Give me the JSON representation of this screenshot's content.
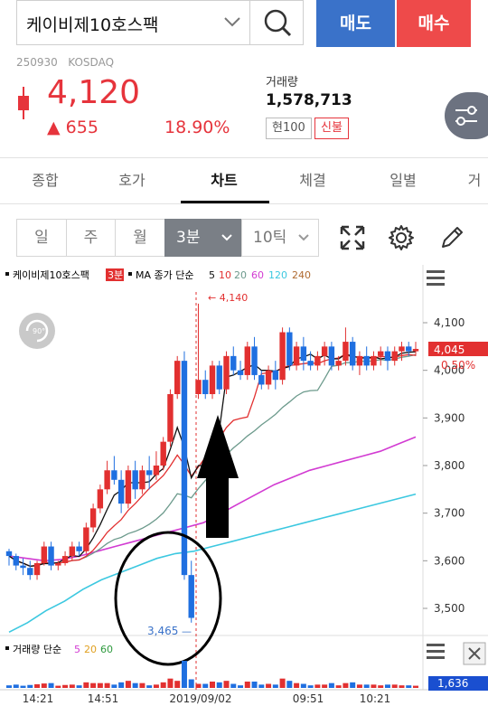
{
  "search": {
    "value": "케이비제10호스팩"
  },
  "actions": {
    "sell": "매도",
    "buy": "매수"
  },
  "stock": {
    "code": "250930",
    "market": "KOSDAQ",
    "price": "4,120",
    "change": "▲ 655",
    "change_pct": "18.90%",
    "volume_label": "거래량",
    "volume": "1,578,713",
    "tags": [
      "현100",
      "신불"
    ]
  },
  "tabs": [
    "종합",
    "호가",
    "차트",
    "체결",
    "일별",
    "거"
  ],
  "active_tab": "차트",
  "periods": [
    "일",
    "주",
    "월",
    "3분",
    "10틱"
  ],
  "selected_period": "3분",
  "chart_legend": {
    "name": "케이비제10호스팩",
    "interval": "3분",
    "ma_label": "MA 종가 단순",
    "ma_periods": [
      "5",
      "10",
      "20",
      "60",
      "120",
      "240"
    ],
    "ma_colors": [
      "#111111",
      "#e23030",
      "#6c9a8c",
      "#d23bd2",
      "#3cc8e0",
      "#b06a30"
    ]
  },
  "volume_legend": {
    "label": "거래량 단순",
    "periods": [
      "5",
      "20",
      "60"
    ],
    "colors": [
      "#d23bd2",
      "#e0a020",
      "#2e9a3e"
    ],
    "last": "1,636"
  },
  "chart_data": {
    "type": "candlestick",
    "y_ticks": [
      "4,100",
      "4,000",
      "3,900",
      "3,800",
      "3,700",
      "3,600",
      "3,500"
    ],
    "x_ticks": [
      "14:21",
      "14:51",
      "2019/09/02",
      "09:51",
      "10:21"
    ],
    "high_label": "4,140",
    "low_label": "3,465",
    "last_price": "4,045",
    "last_pct": "0.50%",
    "candles": [
      [
        3620,
        3625,
        3590,
        3610
      ],
      [
        3610,
        3615,
        3580,
        3590
      ],
      [
        3590,
        3605,
        3570,
        3585
      ],
      [
        3585,
        3600,
        3560,
        3570
      ],
      [
        3570,
        3600,
        3560,
        3595
      ],
      [
        3595,
        3640,
        3590,
        3630
      ],
      [
        3630,
        3640,
        3580,
        3590
      ],
      [
        3590,
        3600,
        3580,
        3595
      ],
      [
        3595,
        3620,
        3590,
        3610
      ],
      [
        3610,
        3640,
        3600,
        3630
      ],
      [
        3630,
        3640,
        3610,
        3620
      ],
      [
        3620,
        3680,
        3615,
        3670
      ],
      [
        3670,
        3720,
        3660,
        3710
      ],
      [
        3710,
        3760,
        3700,
        3750
      ],
      [
        3750,
        3810,
        3740,
        3790
      ],
      [
        3790,
        3820,
        3760,
        3770
      ],
      [
        3770,
        3790,
        3700,
        3720
      ],
      [
        3720,
        3800,
        3710,
        3790
      ],
      [
        3790,
        3810,
        3730,
        3750
      ],
      [
        3750,
        3800,
        3740,
        3790
      ],
      [
        3790,
        3820,
        3750,
        3780
      ],
      [
        3780,
        3830,
        3770,
        3800
      ],
      [
        3800,
        3860,
        3790,
        3850
      ],
      [
        3850,
        3960,
        3840,
        3950
      ],
      [
        3950,
        4030,
        3940,
        4020
      ],
      [
        4020,
        4040,
        3560,
        3570
      ],
      [
        3570,
        3600,
        3470,
        3480
      ],
      [
        3950,
        4140,
        3940,
        3980
      ],
      [
        3980,
        4000,
        3940,
        3950
      ],
      [
        3950,
        4020,
        3940,
        4010
      ],
      [
        4010,
        4020,
        3950,
        3960
      ],
      [
        3960,
        4040,
        3950,
        4030
      ],
      [
        4030,
        4050,
        3990,
        4000
      ],
      [
        4000,
        4020,
        3980,
        3990
      ],
      [
        3990,
        4060,
        3980,
        4050
      ],
      [
        4050,
        4070,
        3980,
        3990
      ],
      [
        3990,
        4000,
        3960,
        3970
      ],
      [
        3970,
        4010,
        3960,
        4000
      ],
      [
        4000,
        4020,
        3960,
        3980
      ],
      [
        3980,
        4090,
        3970,
        4080
      ],
      [
        4080,
        4090,
        4000,
        4010
      ],
      [
        4010,
        4060,
        4000,
        4050
      ],
      [
        4050,
        4070,
        4000,
        4020
      ],
      [
        4020,
        4040,
        4000,
        4010
      ],
      [
        4010,
        4040,
        4000,
        4030
      ],
      [
        4030,
        4060,
        4010,
        4050
      ],
      [
        4050,
        4060,
        4000,
        4010
      ],
      [
        4010,
        4030,
        4000,
        4020
      ],
      [
        4020,
        4090,
        4010,
        4060
      ],
      [
        4060,
        4070,
        4000,
        4010
      ],
      [
        4010,
        4040,
        3990,
        4030
      ],
      [
        4030,
        4050,
        4000,
        4010
      ],
      [
        4010,
        4040,
        4000,
        4030
      ],
      [
        4030,
        4050,
        4010,
        4040
      ],
      [
        4040,
        4050,
        4000,
        4020
      ],
      [
        4020,
        4050,
        4010,
        4040
      ],
      [
        4040,
        4060,
        4020,
        4050
      ],
      [
        4050,
        4060,
        4030,
        4040
      ],
      [
        4040,
        4060,
        4030,
        4045
      ]
    ],
    "ma120": [
      3450,
      3470,
      3495,
      3515,
      3540,
      3560,
      3575,
      3590,
      3605,
      3615,
      3620,
      3630,
      3640,
      3650,
      3660,
      3670,
      3680,
      3690,
      3700,
      3710,
      3720,
      3730,
      3740
    ],
    "ma60": [
      3610,
      3605,
      3600,
      3603,
      3610,
      3620,
      3630,
      3640,
      3650,
      3660,
      3670,
      3680,
      3700,
      3720,
      3740,
      3760,
      3775,
      3790,
      3800,
      3810,
      3820,
      3830,
      3845,
      3860
    ]
  }
}
